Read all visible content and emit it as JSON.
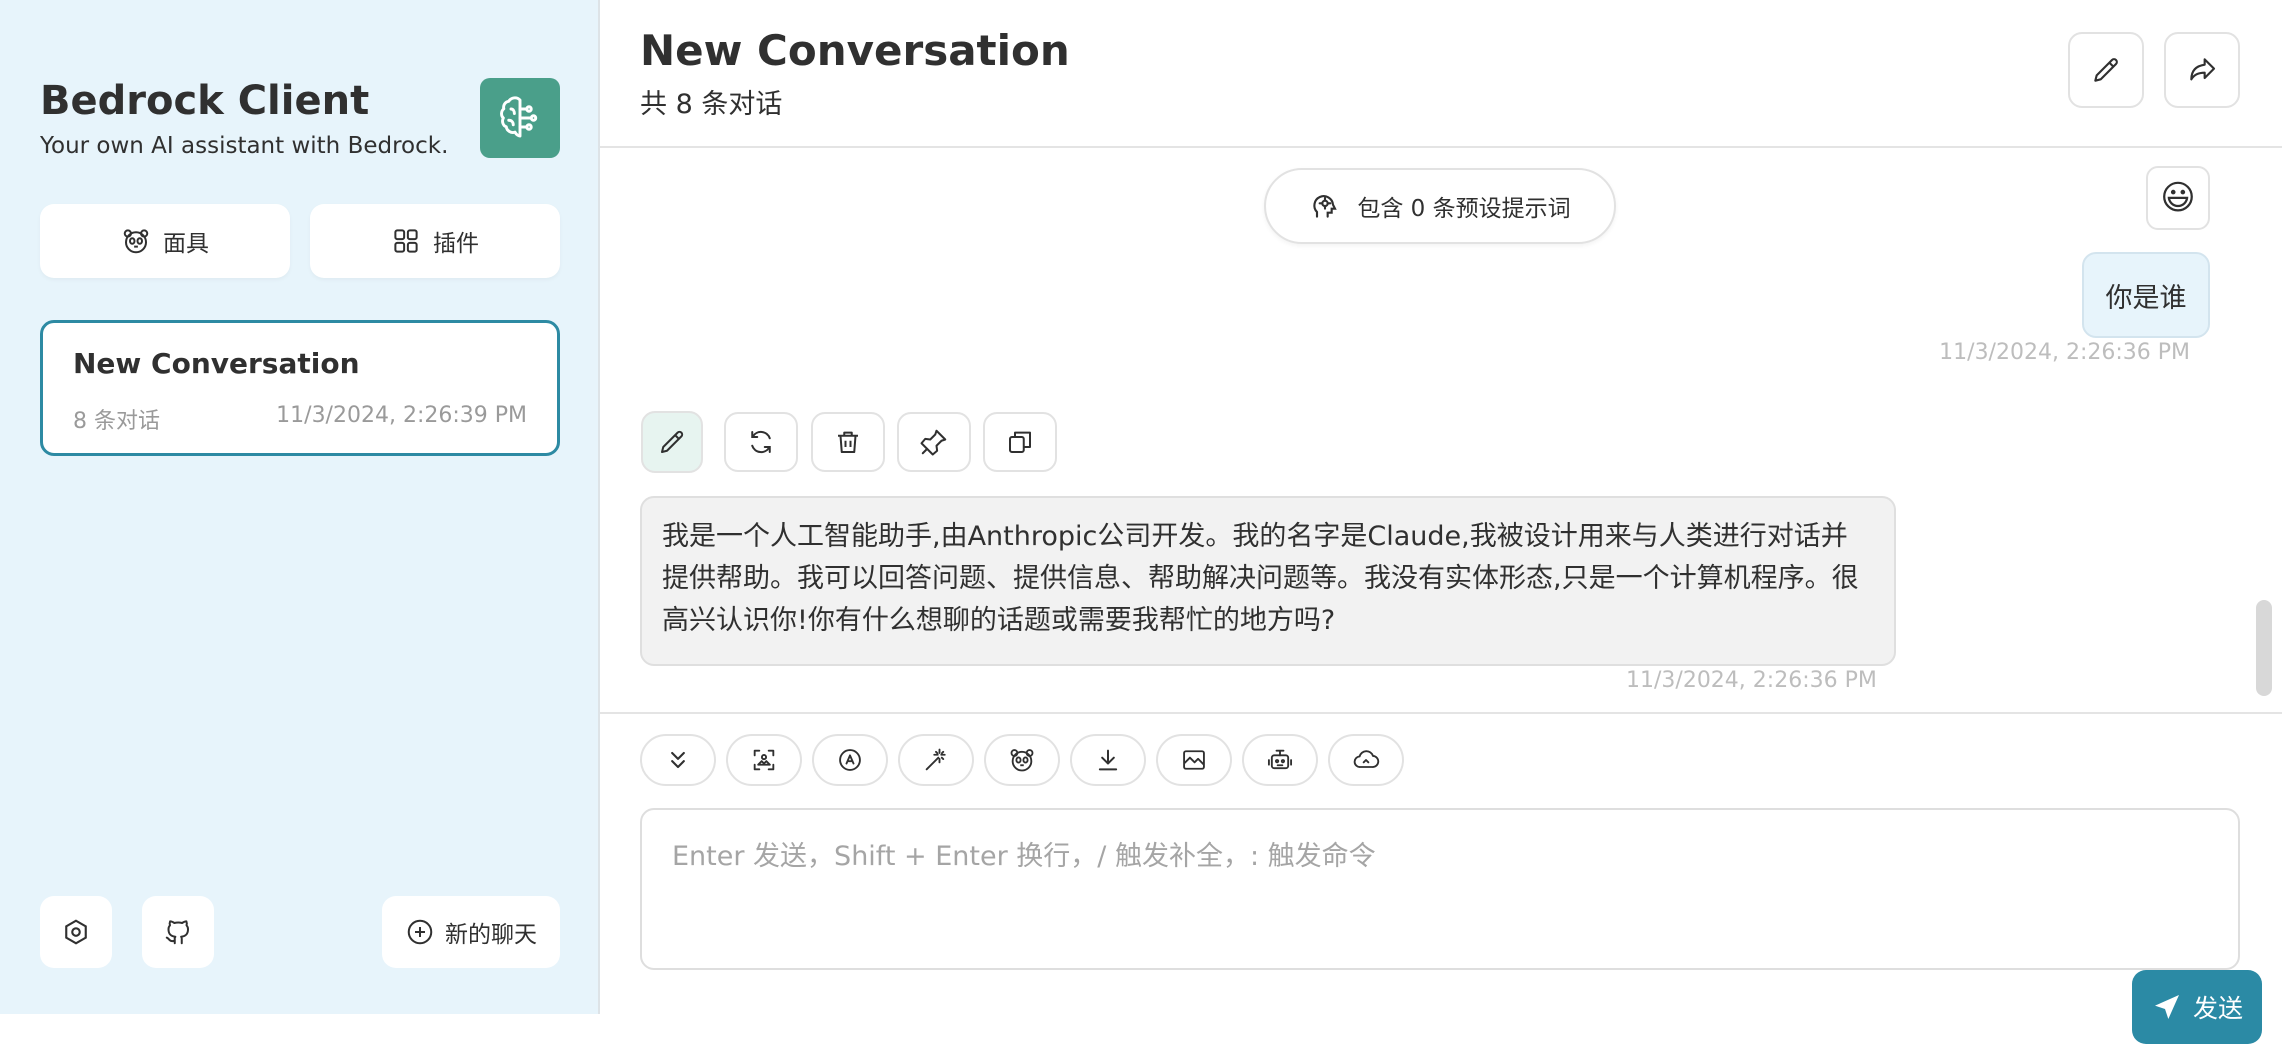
{
  "sidebar": {
    "title": "Bedrock Client",
    "subtitle": "Your own AI assistant with Bedrock.",
    "mask_label": "面具",
    "plugin_label": "插件",
    "conversations": [
      {
        "title": "New Conversation",
        "count": "8 条对话",
        "time": "11/3/2024, 2:26:39 PM"
      }
    ],
    "new_chat_label": "新的聊天"
  },
  "header": {
    "title": "New Conversation",
    "subtitle": "共 8 条对话"
  },
  "chat": {
    "prompt_pill": "包含 0 条预设提示词",
    "avatar_emoji": "😃",
    "messages": [
      {
        "role": "user",
        "text": "你是谁",
        "time": "11/3/2024, 2:26:36 PM"
      },
      {
        "role": "assistant",
        "text": "我是一个人工智能助手,由Anthropic公司开发。我的名字是Claude,我被设计用来与人类进行对话并提供帮助。我可以回答问题、提供信息、帮助解决问题等。我没有实体形态,只是一个计算机程序。很高兴认识你!你有什么想聊的话题或需要我帮忙的地方吗?",
        "time": "11/3/2024, 2:26:36 PM"
      }
    ]
  },
  "input": {
    "placeholder": "Enter 发送，Shift + Enter 换行，/ 触发补全，: 触发命令",
    "send_label": "发送"
  },
  "colors": {
    "accent": "#2b8aa5",
    "sidebar_bg": "#e7f4fb",
    "logo_bg": "#4a9f8a"
  }
}
